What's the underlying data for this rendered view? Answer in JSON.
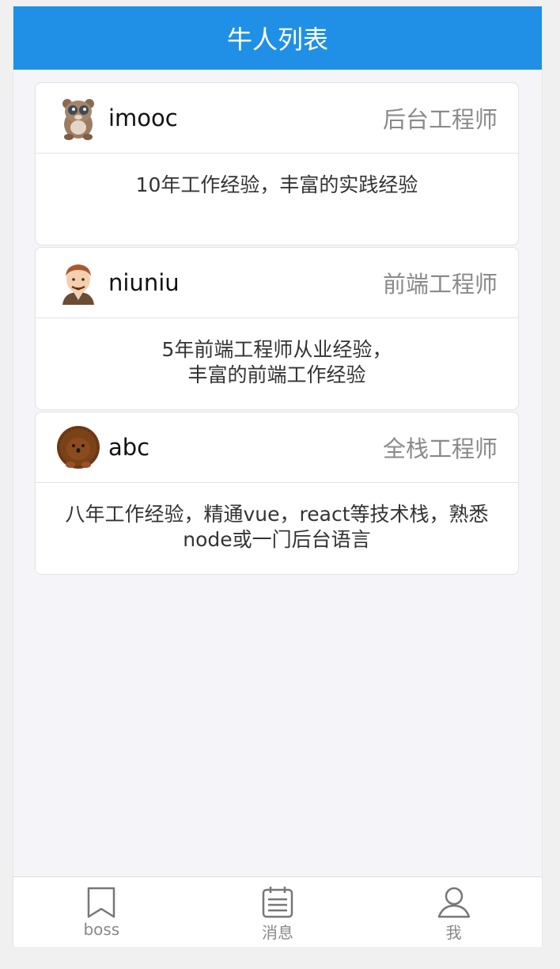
{
  "navbar": {
    "title": "牛人列表"
  },
  "cards": [
    {
      "name": "imooc",
      "title": "后台工程师",
      "avatar_icon": "bear-avatar-icon",
      "desc_lines": [
        "10年工作经验，丰富的实践经验"
      ]
    },
    {
      "name": "niuniu",
      "title": "前端工程师",
      "avatar_icon": "man-avatar-icon",
      "desc_lines": [
        "5年前端工程师从业经验，",
        "丰富的前端工作经验"
      ]
    },
    {
      "name": "abc",
      "title": "全栈工程师",
      "avatar_icon": "hedgehog-avatar-icon",
      "desc_lines": [
        "八年工作经验，精通vue，react等技术栈，熟悉",
        "node或一门后台语言"
      ]
    }
  ],
  "tabbar": {
    "items": [
      {
        "label": "boss",
        "icon": "bookmark-icon"
      },
      {
        "label": "消息",
        "icon": "notepad-icon"
      },
      {
        "label": "我",
        "icon": "user-icon"
      }
    ]
  },
  "colors": {
    "brand": "#2090e6",
    "background": "#f5f5f9",
    "muted_text": "#8a8a8a"
  }
}
